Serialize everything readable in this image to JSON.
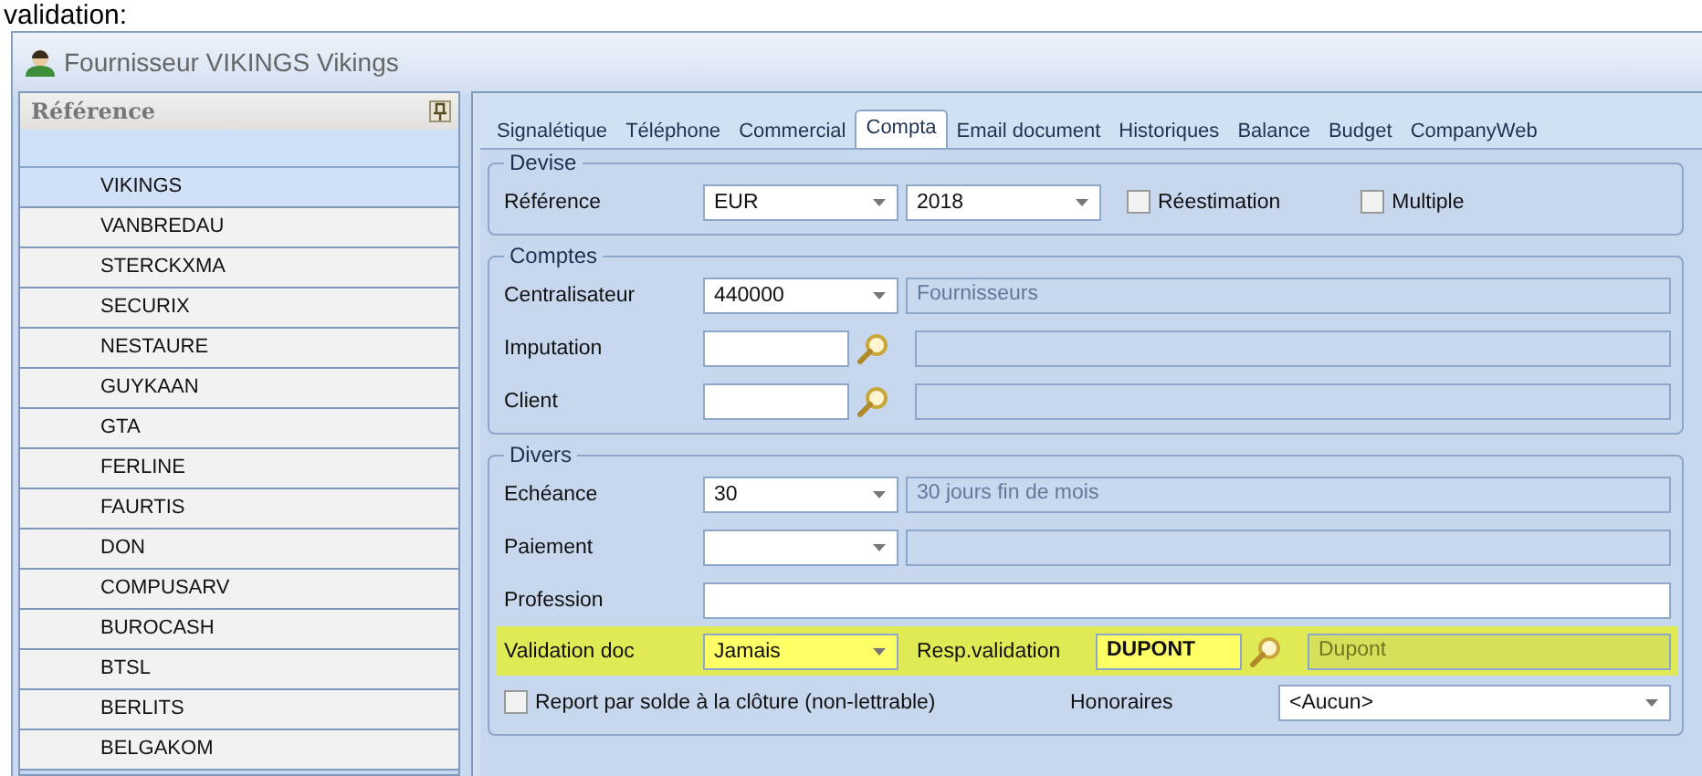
{
  "caption": "validation:",
  "window": {
    "title": "Fournisseur VIKINGS Vikings"
  },
  "sidebar": {
    "header": "Référence",
    "items": [
      {
        "label": "VIKINGS",
        "selected": true
      },
      {
        "label": "VANBREDAU",
        "selected": false
      },
      {
        "label": "STERCKXMA",
        "selected": false
      },
      {
        "label": "SECURIX",
        "selected": false
      },
      {
        "label": "NESTAURE",
        "selected": false
      },
      {
        "label": "GUYKAAN",
        "selected": false
      },
      {
        "label": "GTA",
        "selected": false
      },
      {
        "label": "FERLINE",
        "selected": false
      },
      {
        "label": "FAURTIS",
        "selected": false
      },
      {
        "label": "DON",
        "selected": false
      },
      {
        "label": "COMPUSARV",
        "selected": false
      },
      {
        "label": "BUROCASH",
        "selected": false
      },
      {
        "label": "BTSL",
        "selected": false
      },
      {
        "label": "BERLITS",
        "selected": false
      },
      {
        "label": "BELGAKOM",
        "selected": false
      }
    ]
  },
  "tabs": [
    {
      "label": "Signalétique",
      "selected": false
    },
    {
      "label": "Téléphone",
      "selected": false
    },
    {
      "label": "Commercial",
      "selected": false
    },
    {
      "label": "Compta",
      "selected": true
    },
    {
      "label": "Email document",
      "selected": false
    },
    {
      "label": "Historiques",
      "selected": false
    },
    {
      "label": "Balance",
      "selected": false
    },
    {
      "label": "Budget",
      "selected": false
    },
    {
      "label": "CompanyWeb",
      "selected": false
    }
  ],
  "groups": [
    {
      "title": "Devise",
      "rows": [
        {
          "kind": "fields",
          "label": "Référence",
          "highlighted": false,
          "controls": [
            {
              "kind": "currency",
              "value": "EUR"
            },
            {
              "kind": "year",
              "value": "2018"
            },
            {
              "kind": "check",
              "label": "Réestimation",
              "checked": false
            },
            {
              "kind": "check",
              "label": "Multiple",
              "checked": false
            }
          ]
        }
      ]
    },
    {
      "title": "Comptes",
      "rows": [
        {
          "kind": "fields",
          "label": "Centralisateur",
          "highlighted": false,
          "controls": [
            {
              "kind": "combo",
              "value": "440000"
            },
            {
              "kind": "description",
              "value": "Fournisseurs"
            }
          ]
        },
        {
          "kind": "fields",
          "label": "Imputation",
          "highlighted": false,
          "controls": [
            {
              "kind": "code"
            },
            {
              "kind": "description"
            }
          ]
        },
        {
          "kind": "fields",
          "label": "Client",
          "highlighted": false,
          "controls": [
            {
              "kind": "code"
            },
            {
              "kind": "description"
            }
          ]
        }
      ]
    },
    {
      "title": "Divers",
      "rows": [
        {
          "kind": "fields",
          "label": "Echéance",
          "highlighted": false,
          "controls": [
            {
              "kind": "combo",
              "value": "30"
            },
            {
              "kind": "description",
              "value": "30 jours fin de mois"
            }
          ]
        },
        {
          "kind": "fields",
          "label": "Paiement",
          "highlighted": false,
          "controls": [
            {
              "kind": "combo"
            },
            {
              "kind": "description"
            }
          ]
        },
        {
          "kind": "fields",
          "label": "Profession",
          "highlighted": false,
          "controls": [
            {
              "kind": "field"
            }
          ]
        },
        {
          "kind": "fields",
          "label": "Validation doc",
          "highlighted": true,
          "controls": [
            {
              "kind": "combo",
              "value": "Jamais"
            },
            {
              "kind": "label",
              "label": "Resp.validation"
            },
            {
              "kind": "code",
              "value": "DUPONT"
            },
            {
              "kind": "description",
              "value": "Dupont"
            }
          ]
        },
        {
          "kind": "footer",
          "highlighted": false,
          "controls": [
            {
              "kind": "check",
              "label": "Report par solde à la clôture (non-lettrable)",
              "checked": false
            },
            {
              "kind": "label",
              "label": "Honoraires"
            },
            {
              "kind": "combo",
              "value": "<Aucun>"
            }
          ]
        }
      ]
    }
  ]
}
